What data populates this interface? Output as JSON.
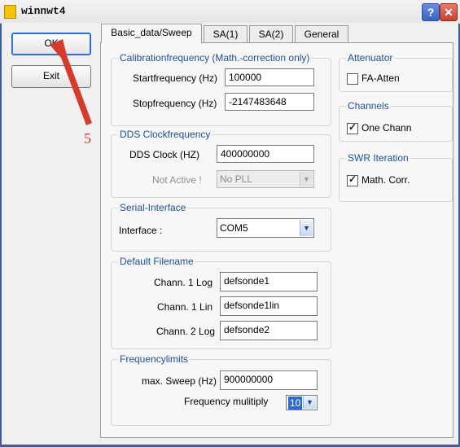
{
  "window": {
    "title": "winnwt4",
    "help_glyph": "?",
    "close_glyph": "✕"
  },
  "buttons": {
    "ok": "OK",
    "exit": "Exit"
  },
  "tabs": [
    "Basic_data/Sweep",
    "SA(1)",
    "SA(2)",
    "General"
  ],
  "calibration": {
    "title": "Calibrationfrequency (Math.-correction only)",
    "start_label": "Startfrequency (Hz)",
    "start_value": "100000",
    "stop_label": "Stopfrequency (Hz)",
    "stop_value": "-2147483648"
  },
  "dds": {
    "title": "DDS Clockfrequency",
    "clock_label": "DDS Clock (HZ)",
    "clock_value": "400000000",
    "notactive_label": "Not Active !",
    "pll_value": "No PLL"
  },
  "serial": {
    "title": "Serial-Interface",
    "interface_label": "Interface :",
    "interface_value": "COM5"
  },
  "filename": {
    "title": "Default Filename",
    "rows": [
      {
        "label": "Chann. 1  Log",
        "value": "defsonde1"
      },
      {
        "label": "Chann. 1  Lin",
        "value": "defsonde1lin"
      },
      {
        "label": "Chann. 2 Log",
        "value": "defsonde2"
      }
    ]
  },
  "freqlimits": {
    "title": "Frequencylimits",
    "sweep_label": "max. Sweep (Hz)",
    "sweep_value": "900000000",
    "multiply_label": "Frequency mulitiply",
    "multiply_value": "10"
  },
  "attenuator": {
    "title": "Attenuator",
    "label": "FA-Atten",
    "checked": false
  },
  "channels": {
    "title": "Channels",
    "label": "One Chann",
    "checked": true
  },
  "swr": {
    "title": "SWR Iteration",
    "label": "Math. Corr.",
    "checked": true
  },
  "annotation": {
    "number": "5",
    "color": "#d43b2a"
  }
}
